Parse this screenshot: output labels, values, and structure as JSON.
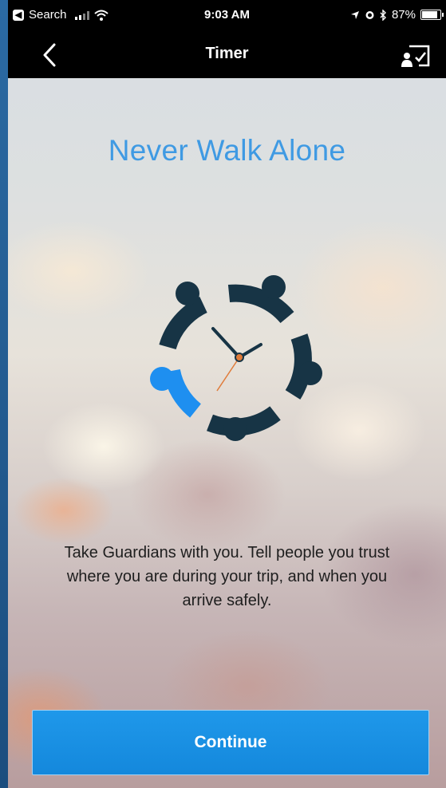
{
  "status_bar": {
    "back_app_label": "Search",
    "time": "9:03 AM",
    "battery_percent": "87%",
    "battery_level": 0.87
  },
  "nav": {
    "title": "Timer"
  },
  "onboarding": {
    "headline": "Never Walk Alone",
    "description": "Take Guardians with you. Tell people you trust where you are during your trip, and when you arrive safely.",
    "continue_label": "Continue"
  },
  "colors": {
    "accent": "#3f9ae3",
    "button": "#1a8fe3",
    "logo_dark": "#173445",
    "logo_blue": "#1e8ff0"
  },
  "icons": [
    "back-app-icon",
    "signal-icon",
    "wifi-icon",
    "location-icon",
    "alarm-icon",
    "bluetooth-icon",
    "battery-icon",
    "back-chevron-icon",
    "share-check-icon",
    "guardians-clock-logo"
  ]
}
